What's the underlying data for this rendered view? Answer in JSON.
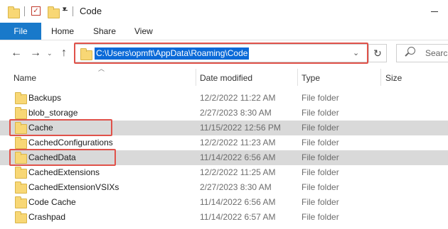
{
  "window": {
    "title": "Code"
  },
  "ribbon": {
    "tabs": [
      "File",
      "Home",
      "Share",
      "View"
    ]
  },
  "address": {
    "path": "C:\\Users\\opmft\\AppData\\Roaming\\Code",
    "search_placeholder": "Search"
  },
  "columns": {
    "name": "Name",
    "date": "Date modified",
    "type": "Type",
    "size": "Size"
  },
  "files": [
    {
      "name": "Backups",
      "date": "12/2/2022 11:22 AM",
      "type": "File folder",
      "selected": false,
      "highlighted": false
    },
    {
      "name": "blob_storage",
      "date": "2/27/2023 8:30 AM",
      "type": "File folder",
      "selected": false,
      "highlighted": false
    },
    {
      "name": "Cache",
      "date": "11/15/2022 12:56 PM",
      "type": "File folder",
      "selected": true,
      "highlighted": true
    },
    {
      "name": "CachedConfigurations",
      "date": "12/2/2022 11:23 AM",
      "type": "File folder",
      "selected": false,
      "highlighted": false
    },
    {
      "name": "CachedData",
      "date": "11/14/2022 6:56 AM",
      "type": "File folder",
      "selected": true,
      "highlighted": true
    },
    {
      "name": "CachedExtensions",
      "date": "12/2/2022 11:25 AM",
      "type": "File folder",
      "selected": false,
      "highlighted": false
    },
    {
      "name": "CachedExtensionVSIXs",
      "date": "2/27/2023 8:30 AM",
      "type": "File folder",
      "selected": false,
      "highlighted": false
    },
    {
      "name": "Code Cache",
      "date": "11/14/2022 6:56 AM",
      "type": "File folder",
      "selected": false,
      "highlighted": false
    },
    {
      "name": "Crashpad",
      "date": "11/14/2022 6:57 AM",
      "type": "File folder",
      "selected": false,
      "highlighted": false
    }
  ],
  "colors": {
    "file_tab": "#1979ca",
    "address_selection": "#0b6ad8",
    "highlight_box": "#e0524a",
    "selected_row": "#d9d9d9",
    "folder": "#f8d775"
  },
  "icons": [
    "folder-icon",
    "checkmark-icon",
    "dropdown-icon",
    "back-arrow-icon",
    "forward-arrow-icon",
    "up-arrow-icon",
    "chevron-down-icon",
    "refresh-icon",
    "search-icon",
    "minimize-icon",
    "sort-ascending-icon"
  ]
}
